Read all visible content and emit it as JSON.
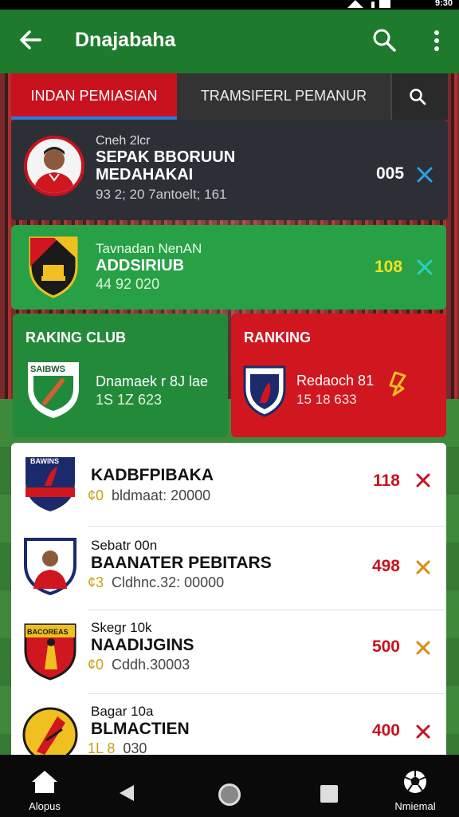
{
  "status_bar": {
    "time": "9:30"
  },
  "app_bar": {
    "title": "Dnajabaha"
  },
  "tabs": [
    {
      "label": "INDAN PEMIASIAN"
    },
    {
      "label": "TRAMSIFERL PEMANUR"
    }
  ],
  "featured": {
    "small": "Cneh 2lcr",
    "name1": "SEPAK BBORUUN",
    "name2": "MEDAHAKAI",
    "meta": "93 2; 20 7antoelt; 161",
    "score": "005"
  },
  "club_card": {
    "small": "Tavnadan NenAN",
    "name": "ADDSIRIUB",
    "meta": "44 92 020",
    "score": "108"
  },
  "ranking_club": {
    "heading": "RAKING CLUB",
    "crest_text": "SAIBWS",
    "name": "Dnamaek r 8J lae",
    "meta": "1S 1Z 623"
  },
  "ranking": {
    "heading": "RANKING",
    "name": "Redaoch 81",
    "meta": "15 18 633"
  },
  "list": [
    {
      "small": "",
      "name": "KADBFPIBAKA",
      "meta": "bldmaat: 20000",
      "prefix": "¢0",
      "score": "118",
      "color": "#c8121e"
    },
    {
      "small": "Sebatr 00n",
      "name": "BAANATER PEBITARS",
      "meta": "Cldhnc.32: 00000",
      "prefix": "¢3",
      "score": "498",
      "color": "#d98a10"
    },
    {
      "small": "Skegr 10k",
      "name": "NAADIJGINS",
      "meta": "Cddh.30003",
      "prefix": "¢0",
      "score": "500",
      "color": "#d98a10"
    },
    {
      "small": "Bagar 10a",
      "name": "BLMACTIEN",
      "meta": "030",
      "prefix": "1L 8",
      "score": "400",
      "color": "#c8121e"
    }
  ],
  "crest_labels": {
    "row1": "BAWINS",
    "row3": "BACOREAS"
  },
  "nav": {
    "home_label": "Alopus",
    "ball_label": "Nmiemal"
  }
}
